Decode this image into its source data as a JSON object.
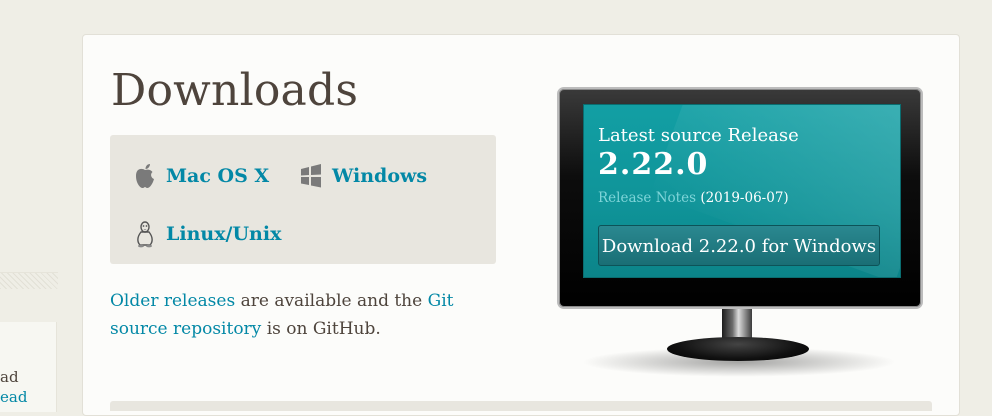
{
  "page": {
    "title": "Downloads"
  },
  "platforms": [
    {
      "label": "Mac OS X",
      "icon": "apple-icon"
    },
    {
      "label": "Windows",
      "icon": "windows-icon"
    },
    {
      "label": "Linux/Unix",
      "icon": "linux-penguin-icon"
    }
  ],
  "older": {
    "link1": "Older releases",
    "text1": " are available and the ",
    "link2": "Git source repository",
    "text2": " is on GitHub."
  },
  "monitor": {
    "heading": "Latest source Release",
    "version": "2.22.0",
    "release_notes_label": "Release Notes",
    "release_date": "(2019-06-07)",
    "download_button": "Download 2.22.0 for Windows"
  },
  "sidebar_fragment": {
    "line1": "ad",
    "line2": "ead"
  },
  "colors": {
    "accent": "#0388a6",
    "text": "#4e443c",
    "screen": "#129fa4",
    "background": "#efeee6"
  }
}
